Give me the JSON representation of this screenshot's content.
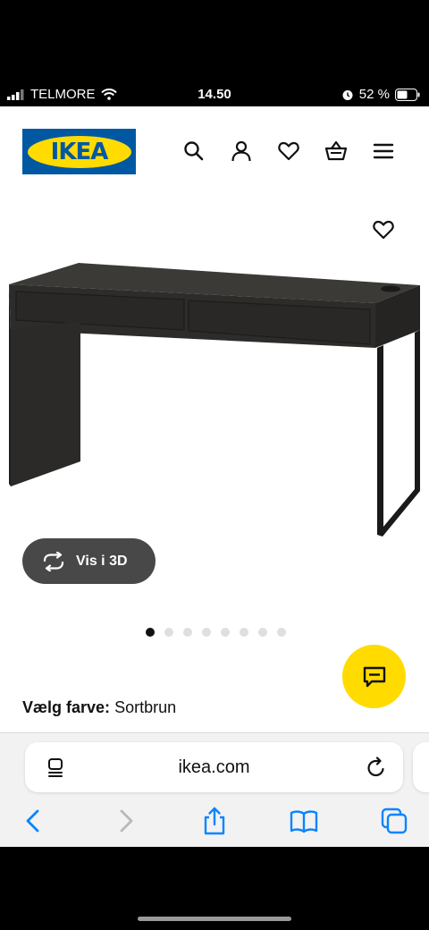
{
  "status_bar": {
    "carrier": "TELMORE",
    "time": "14.50",
    "battery": "52 %"
  },
  "header": {
    "logo_text": "IKEA",
    "icons": [
      "search-icon",
      "account-icon",
      "heart-icon",
      "basket-icon",
      "menu-icon"
    ]
  },
  "product": {
    "view_3d_label": "Vis i 3D",
    "gallery": {
      "total": 8,
      "active_index": 0
    },
    "color_label": "Vælg farve:",
    "color_value": "Sortbrun"
  },
  "browser": {
    "url": "ikea.com",
    "toolbar": [
      "back-icon",
      "forward-icon",
      "share-icon",
      "bookmarks-icon",
      "tabs-icon"
    ]
  },
  "colors": {
    "ikea_blue": "#0058a3",
    "ikea_yellow": "#ffdb00",
    "button_dark": "#484848",
    "ios_blue": "#0a84ff"
  }
}
